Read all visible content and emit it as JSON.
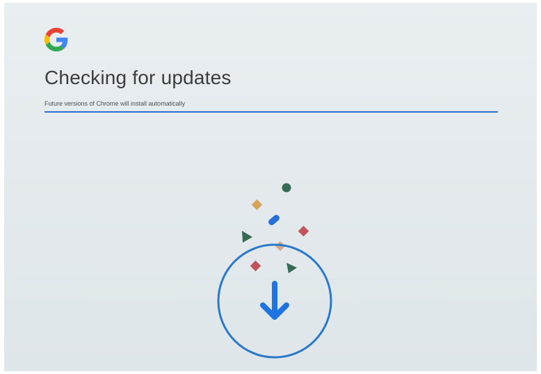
{
  "header": {
    "logo": "google-g-logo",
    "title": "Checking for updates",
    "subtitle": "Future versions of Chrome will install automatically"
  },
  "progress": {
    "fraction": 1.0,
    "color": "#2f6fd0"
  },
  "animation": {
    "circle_color": "#2a79c9",
    "arrow_color": "#1f74e0",
    "shape_colors": {
      "green": "#356a55",
      "yellow": "#d6a35a",
      "blue": "#2a6fd6",
      "red": "#c1545b"
    }
  },
  "brand_colors": {
    "blue": "#4285F4",
    "red": "#EA4335",
    "yellow": "#FBBC05",
    "green": "#34A853"
  }
}
